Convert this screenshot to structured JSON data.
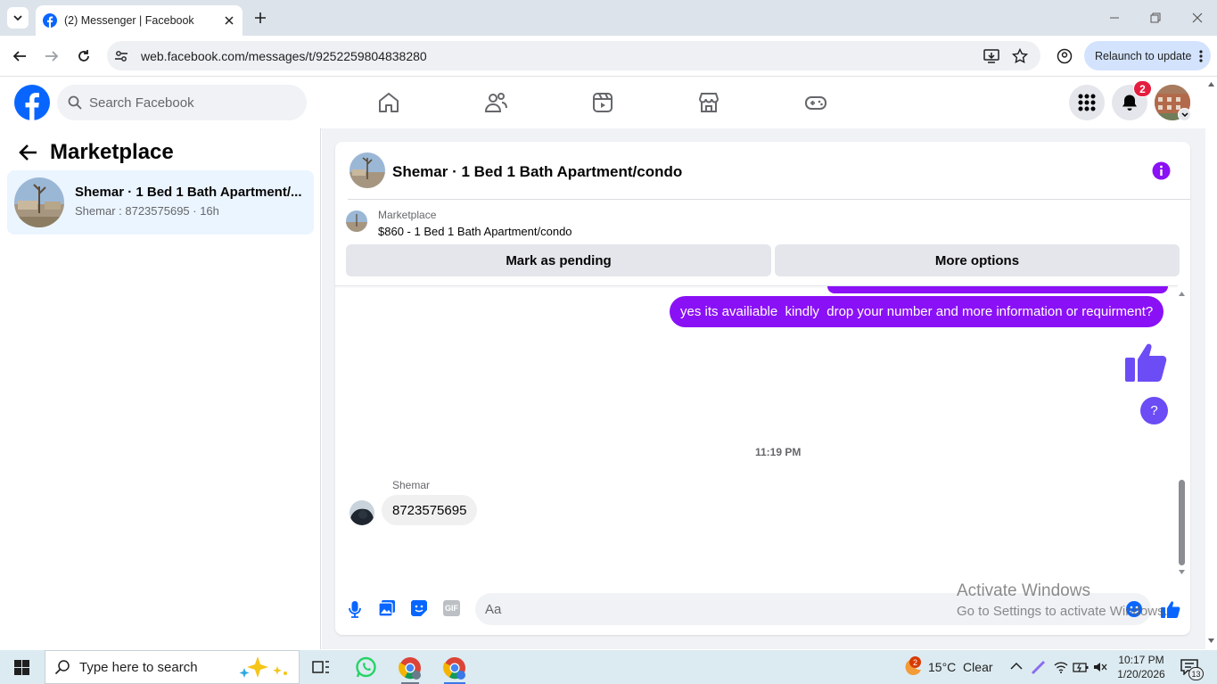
{
  "browser": {
    "tab_title": "(2) Messenger | Facebook",
    "url": "web.facebook.com/messages/t/9252259804838280",
    "relaunch_label": "Relaunch to update"
  },
  "facebook": {
    "search_placeholder": "Search Facebook",
    "notification_count": "2"
  },
  "sidebar": {
    "title": "Marketplace",
    "conversation": {
      "name": "Shemar · 1 Bed 1 Bath Apartment/...",
      "preview": "Shemar : 8723575695 · 16h"
    }
  },
  "chat": {
    "title": "Shemar · 1 Bed 1 Bath Apartment/condo",
    "listing_label": "Marketplace",
    "listing_price": "$860 - 1 Bed 1 Bath Apartment/condo",
    "mark_pending_label": "Mark as pending",
    "more_options_label": "More options",
    "outgoing_message": "yes its availiable  kindly  drop your number and more information or requirment?",
    "question_bubble": "?",
    "timestamp": "11:19 PM",
    "sender_name": "Shemar",
    "incoming_message": "8723575695",
    "composer_placeholder": "Aa",
    "gif_label": "GIF"
  },
  "watermark": {
    "line1": "Activate Windows",
    "line2": "Go to Settings to activate Windows."
  },
  "taskbar": {
    "search_placeholder": "Type here to search",
    "weather": "15°C  Clear",
    "weather_badge": "2",
    "time": "10:17 PM",
    "date": "1/20/2026",
    "notif_count": "13"
  },
  "colors": {
    "fb_blue": "#0866ff",
    "messenger_purple": "#8a11f5",
    "thumb_blue": "#6c4cf5"
  }
}
